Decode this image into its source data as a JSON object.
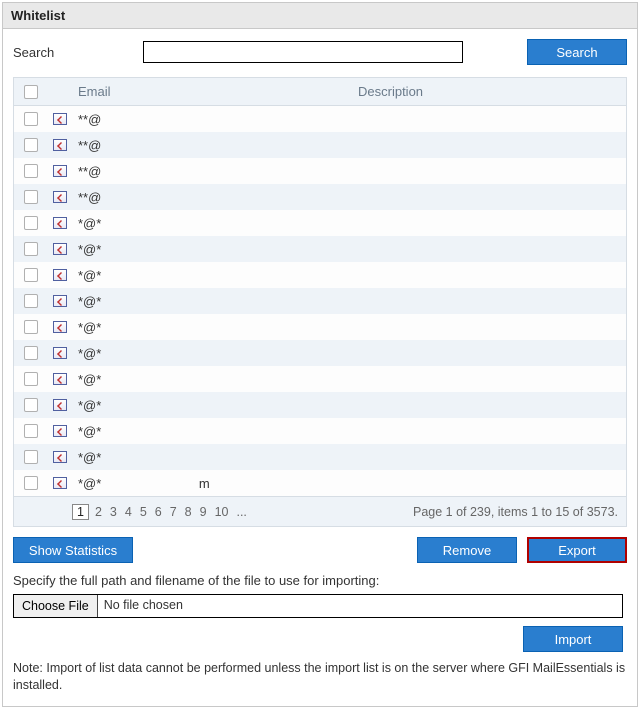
{
  "panel": {
    "title": "Whitelist"
  },
  "search": {
    "label": "Search",
    "value": "",
    "button": "Search"
  },
  "grid": {
    "headers": {
      "email": "Email",
      "description": "Description"
    },
    "rows": [
      {
        "email": "**@",
        "description": ""
      },
      {
        "email": "**@",
        "description": ""
      },
      {
        "email": "**@",
        "description": ""
      },
      {
        "email": "**@",
        "description": ""
      },
      {
        "email": "*@*",
        "description": ""
      },
      {
        "email": "*@*",
        "description": ""
      },
      {
        "email": "*@*",
        "description": ""
      },
      {
        "email": "*@*",
        "description": ""
      },
      {
        "email": "*@*",
        "description": ""
      },
      {
        "email": "*@*",
        "description": ""
      },
      {
        "email": "*@*",
        "description": ""
      },
      {
        "email": "*@*",
        "description": ""
      },
      {
        "email": "*@*",
        "description": ""
      },
      {
        "email": "*@*",
        "description": ""
      },
      {
        "email": "*@*                           m",
        "description": ""
      }
    ]
  },
  "pager": {
    "current": "1",
    "pages": [
      "2",
      "3",
      "4",
      "5",
      "6",
      "7",
      "8",
      "9",
      "10",
      "..."
    ],
    "info": "Page 1 of 239, items 1 to 15 of 3573."
  },
  "actions": {
    "show_stats": "Show Statistics",
    "remove": "Remove",
    "export": "Export"
  },
  "import": {
    "label": "Specify the full path and filename of the file to use for importing:",
    "choose": "Choose File",
    "status": "No file chosen",
    "button": "Import"
  },
  "note": "Note: Import of list data cannot be performed unless the import list is on the server where GFI MailEssentials is installed."
}
